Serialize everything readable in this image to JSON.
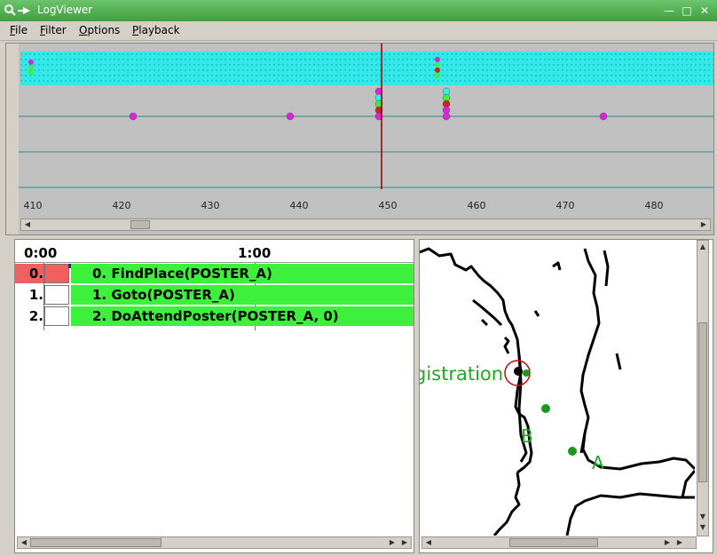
{
  "window": {
    "title": "LogViewer"
  },
  "menu": [
    {
      "label": "File",
      "mnemonic": "F",
      "rest": "ile"
    },
    {
      "label": "Filter",
      "mnemonic": "F",
      "rest": "ilter"
    },
    {
      "label": "Options",
      "mnemonic": "O",
      "rest": "ptions"
    },
    {
      "label": "Playback",
      "mnemonic": "P",
      "rest": "layback"
    }
  ],
  "timeline": {
    "ticks": [
      "410",
      "420",
      "430",
      "440",
      "450",
      "460",
      "470",
      "480"
    ],
    "cursor_value": 449.3
  },
  "task_list": {
    "time_start": "0:00",
    "time_mid": "1:00",
    "rows": [
      {
        "num": "0.",
        "label": "0. FindPlace(POSTER_A)",
        "active": true
      },
      {
        "num": "1.",
        "label": "1. Goto(POSTER_A)",
        "active": false
      },
      {
        "num": "2.",
        "label": "2. DoAttendPoster(POSTER_A, 0)",
        "active": false
      }
    ]
  },
  "map": {
    "labels": {
      "registration": "gistration",
      "b": "B",
      "a": "A"
    },
    "colors": {
      "label": "#22aa22",
      "point": "#1a9a1a",
      "robot_ring": "#cc0000"
    }
  },
  "colors": {
    "titlebar": "#4fae4f",
    "timeline_bg": "#c0c0c0",
    "dot_cyan": "#33f0f0",
    "dot_magenta": "#e020e0",
    "task_bar": "#3cf03c",
    "task_active": "#f06060",
    "cursor": "#8b0000"
  }
}
